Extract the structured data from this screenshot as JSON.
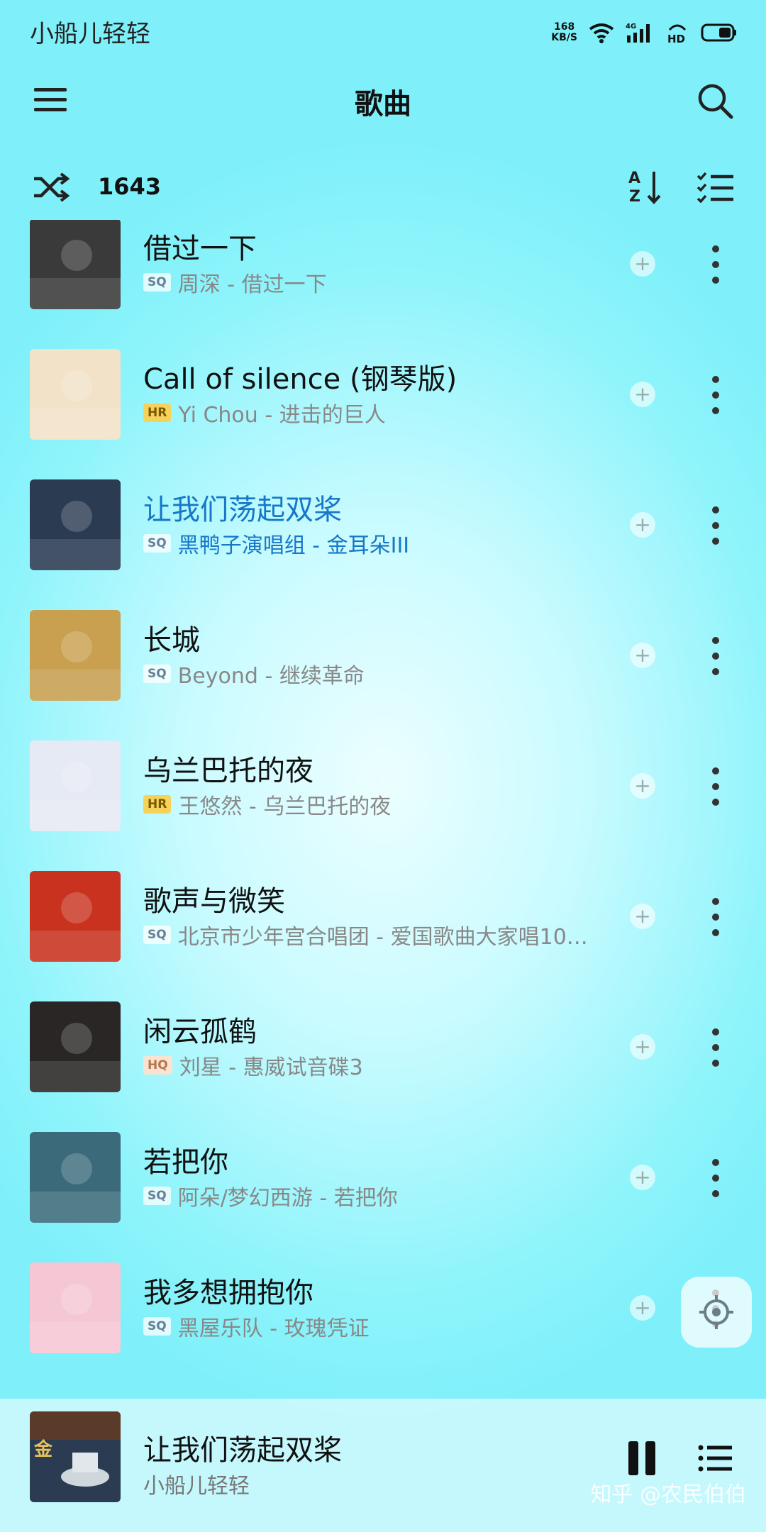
{
  "status_bar": {
    "carrier_text": "小船儿轻轻",
    "speed_value": "168",
    "speed_unit": "KB/S",
    "network": "4G",
    "hd": "HD",
    "icons": [
      "wifi-icon",
      "signal-icon",
      "hd-icon",
      "battery-icon"
    ]
  },
  "app_bar": {
    "title": "歌曲",
    "left_icon": "menu-icon",
    "right_icon": "search-icon"
  },
  "toolbar": {
    "shuffle_icon": "shuffle-icon",
    "count": "1643",
    "sort_icon": "sort-az-icon",
    "multi_select_icon": "checklist-icon"
  },
  "songs": [
    {
      "title": "借过一下",
      "quality": "SQ",
      "artist": "周深",
      "album": "借过一下",
      "cover_color": "#3a3a3a"
    },
    {
      "title": "Call of silence (钢琴版)",
      "quality": "HR",
      "artist": "Yi Chou",
      "album": "进击的巨人",
      "cover_color": "#f2e2c8"
    },
    {
      "title": "让我们荡起双桨",
      "quality": "SQ",
      "artist": "黑鸭子演唱组",
      "album": "金耳朵III",
      "cover_color": "#2b3b52",
      "playing": true
    },
    {
      "title": "长城",
      "quality": "SQ",
      "artist": "Beyond",
      "album": "继续革命",
      "cover_color": "#c8a050"
    },
    {
      "title": "乌兰巴托的夜",
      "quality": "HR",
      "artist": "王悠然",
      "album": "乌兰巴托的夜",
      "cover_color": "#e6eaf4"
    },
    {
      "title": "歌声与微笑",
      "quality": "SQ",
      "artist": "北京市少年宫合唱团",
      "album": "爱国歌曲大家唱100...",
      "cover_color": "#c8321e"
    },
    {
      "title": "闲云孤鹤",
      "quality": "HQ",
      "artist": "刘星",
      "album": "惠威试音碟3",
      "cover_color": "#2a2626"
    },
    {
      "title": "若把你",
      "quality": "SQ",
      "artist": "阿朵/梦幻西游",
      "album": "若把你",
      "cover_color": "#3b6b7a"
    },
    {
      "title": "我多想拥抱你",
      "quality": "SQ",
      "artist": "黑屋乐队",
      "album": "玫瑰凭证",
      "cover_color": "#f5c6d4"
    }
  ],
  "now_playing": {
    "title": "让我们荡起双桨",
    "artist": "小船儿轻轻"
  },
  "watermark": "知乎 @农民伯伯",
  "colors": {
    "accent": "#1677c9",
    "background": "#8ff4fb"
  }
}
